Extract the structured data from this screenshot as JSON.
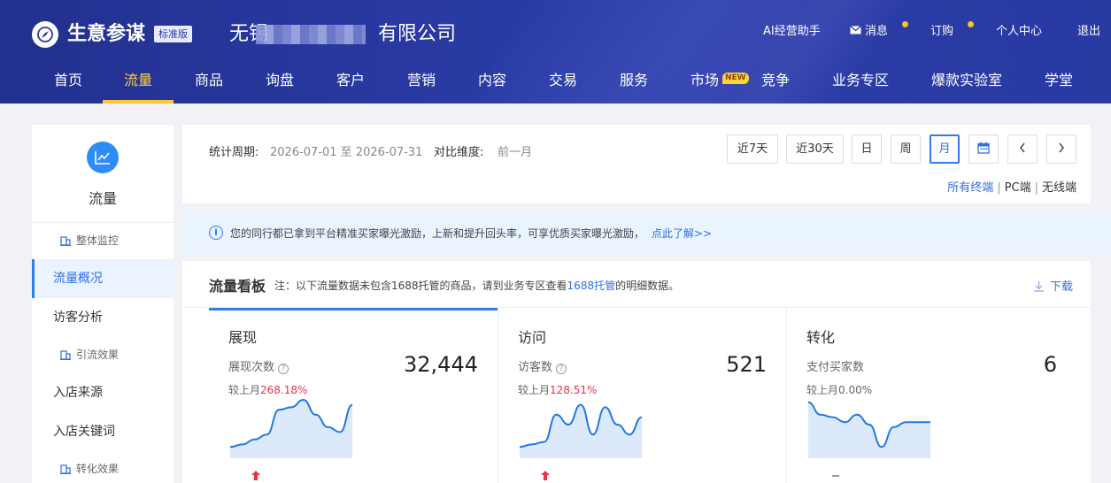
{
  "header": {
    "brand": "生意参谋",
    "edition": "标准版",
    "company_prefix": "无锡",
    "company_suffix": "有限公司",
    "links": {
      "ai": "AI经营助手",
      "msg": "消息",
      "subscribe": "订购",
      "profile": "个人中心",
      "logout": "退出"
    },
    "nav": [
      "首页",
      "流量",
      "商品",
      "询盘",
      "客户",
      "营销",
      "内容",
      "交易",
      "服务",
      "市场",
      "竞争",
      "业务专区",
      "爆款实验室",
      "学堂"
    ],
    "nav_active": "流量",
    "new_badge": "NEW"
  },
  "sidebar": {
    "title": "流量",
    "groups": {
      "monitor": "整体监控",
      "traffic_effect": "引流效果",
      "conversion_effect": "转化效果"
    },
    "items": {
      "overview": "流量概况",
      "visitor": "访客分析",
      "source": "入店来源",
      "keywords": "入店关键词"
    }
  },
  "filter": {
    "period_label": "统计周期:",
    "period_value": "2026-07-01 至 2026-07-31",
    "compare_label": "对比维度:",
    "compare_value": "前一月",
    "ranges": [
      "近7天",
      "近30天",
      "日",
      "周",
      "月"
    ],
    "range_active": "月",
    "terminals": [
      "所有终端",
      "PC端",
      "无线端"
    ],
    "terminal_sep": "|"
  },
  "notice": {
    "text": "您的同行都已拿到平台精准买家曝光激励，上新和提升回头率，可享优质买家曝光激励，",
    "link": "点此了解>>"
  },
  "board": {
    "title": "流量看板",
    "note_prefix": "注：以下流量数据未包含1688托管的商品，请到业务专区查看",
    "note_hl": "1688托管",
    "note_suffix": "的明细数据。",
    "download": "下载",
    "kpis": [
      {
        "name": "展现",
        "metric": "展现次数",
        "value": "32,444",
        "cmp_label": "较上月",
        "cmp_value": "268.18%",
        "trend": "up",
        "spark": [
          0.05,
          0.1,
          0.2,
          0.3,
          0.8,
          0.85,
          1.0,
          0.7,
          0.45,
          0.35,
          0.9
        ]
      },
      {
        "name": "访问",
        "metric": "访客数",
        "value": "521",
        "cmp_label": "较上月",
        "cmp_value": "128.51%",
        "trend": "up",
        "spark": [
          0.05,
          0.1,
          0.15,
          0.7,
          0.5,
          0.9,
          0.3,
          0.85,
          0.5,
          0.3,
          0.65
        ]
      },
      {
        "name": "转化",
        "metric": "支付买家数",
        "value": "6",
        "cmp_label": "较上月",
        "cmp_value": "0.00%",
        "trend": "flat",
        "spark": [
          0.95,
          0.7,
          0.65,
          0.55,
          0.7,
          0.5,
          0.05,
          0.45,
          0.55,
          0.55,
          0.55
        ]
      }
    ]
  },
  "colors": {
    "header": "#2a3aa3",
    "accent": "#2f7cf0",
    "active_nav": "#ffd43b",
    "up": "#e8334a"
  }
}
